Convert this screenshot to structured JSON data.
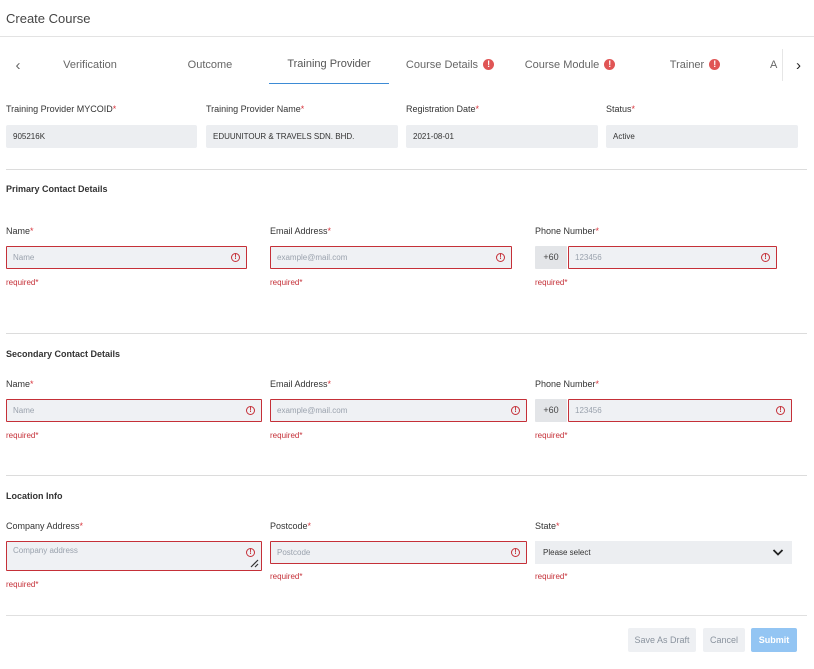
{
  "window": {
    "title": "Create Course"
  },
  "tabs": [
    {
      "label": "Verification",
      "warning": false
    },
    {
      "label": "Outcome",
      "warning": false
    },
    {
      "label": "Training Provider",
      "warning": false,
      "active": true
    },
    {
      "label": "Course Details",
      "warning": true
    },
    {
      "label": "Course Module",
      "warning": true
    },
    {
      "label": "Trainer",
      "warning": true
    },
    {
      "label": "A",
      "warning": false
    }
  ],
  "nav": {
    "prev": "‹",
    "next": "›"
  },
  "required_mark": "*",
  "provider": {
    "mycoid_label": "Training Provider MYCOID",
    "mycoid_value": "905216K",
    "name_label": "Training Provider Name",
    "name_value": "EDUUNITOUR & TRAVELS SDN. BHD.",
    "date_label": "Registration Date",
    "date_value": "2021-08-01",
    "status_label": "Status",
    "status_value": "Active"
  },
  "primary": {
    "section_title": "Primary Contact Details",
    "name_label": "Name",
    "name_placeholder": "Name",
    "email_label": "Email Address",
    "email_placeholder": "example@mail.com",
    "phone_label": "Phone Number",
    "phone_prefix": "+60",
    "phone_placeholder": "123456"
  },
  "secondary": {
    "section_title": "Secondary Contact Details",
    "name_label": "Name",
    "name_placeholder": "Name",
    "email_label": "Email Address",
    "email_placeholder": "example@mail.com",
    "phone_label": "Phone Number",
    "phone_prefix": "+60",
    "phone_placeholder": "123456"
  },
  "location": {
    "section_title": "Location Info",
    "address_label": "Company Address",
    "address_placeholder": "Company address",
    "postcode_label": "Postcode",
    "postcode_placeholder": "Postcode",
    "state_label": "State",
    "state_value": "Please select"
  },
  "validation": {
    "required": "required*",
    "error_icon": "!"
  },
  "actions": {
    "draft": "Save As Draft",
    "cancel": "Cancel",
    "submit": "Submit"
  },
  "colors": {
    "accent": "#3d8bd5",
    "error": "#c53038",
    "warning": "#e05555",
    "submit": "#93c5f3"
  }
}
